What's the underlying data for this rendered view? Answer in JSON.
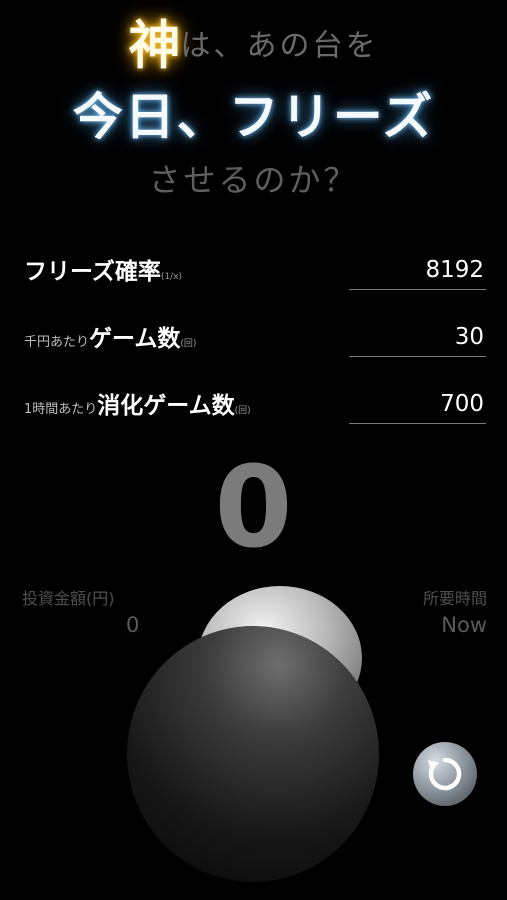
{
  "title": {
    "kami": "神",
    "line1_rest": "は、あの台を",
    "line2": "今日、フリーズ",
    "line3": "させるのか？"
  },
  "settings": [
    {
      "prefix": "",
      "label": "フリーズ確率",
      "unit": "(1/x)",
      "value": "8192"
    },
    {
      "prefix": "千円あたり",
      "label": "ゲーム数",
      "unit": "(回)",
      "value": "30"
    },
    {
      "prefix": "1時間あたり",
      "label": "消化ゲーム数",
      "unit": "(回)",
      "value": "700"
    }
  ],
  "counter": "0",
  "investment": {
    "label": "投資金額(円)",
    "value": "0"
  },
  "required_time": {
    "label": "所要時間",
    "value": "Now"
  },
  "colors": {
    "background": "#000000",
    "kami_glow": "#ffcc33",
    "title_glow": "#7fc8ff",
    "dim_text": "#5e5e5e"
  },
  "icons": {
    "reset": "rotate-arrow-icon",
    "lever": "lever-ball-icon"
  }
}
